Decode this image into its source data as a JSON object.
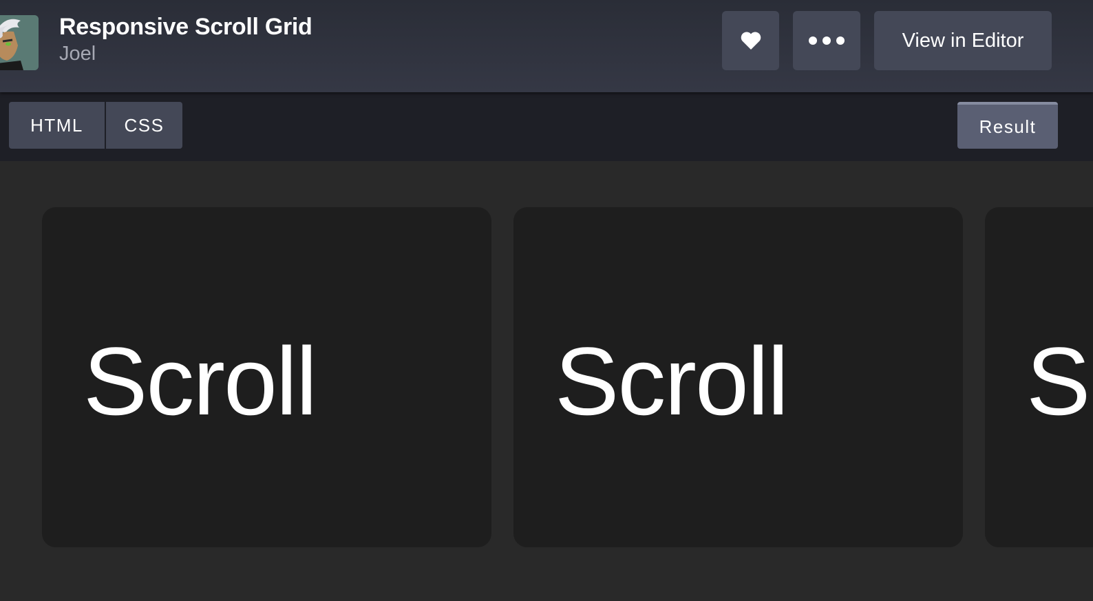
{
  "pen": {
    "title": "Responsive Scroll Grid",
    "author": "Joel",
    "avatar_icon": "cartoon-avatar"
  },
  "header": {
    "like_icon": "heart-icon",
    "more_icon": "more-dots-icon",
    "view_in_editor_label": "View in Editor"
  },
  "tabs": {
    "html_label": "HTML",
    "css_label": "CSS",
    "result_label": "Result"
  },
  "result": {
    "cards": [
      {
        "text": "Scroll"
      },
      {
        "text": "Scroll"
      },
      {
        "text": "Scroll"
      }
    ]
  },
  "colors": {
    "header_bg": "#2f323d",
    "button_bg": "#444857",
    "tabbar_bg": "#1e1f26",
    "result_bg": "#292929",
    "card_bg": "#1e1e1e"
  }
}
